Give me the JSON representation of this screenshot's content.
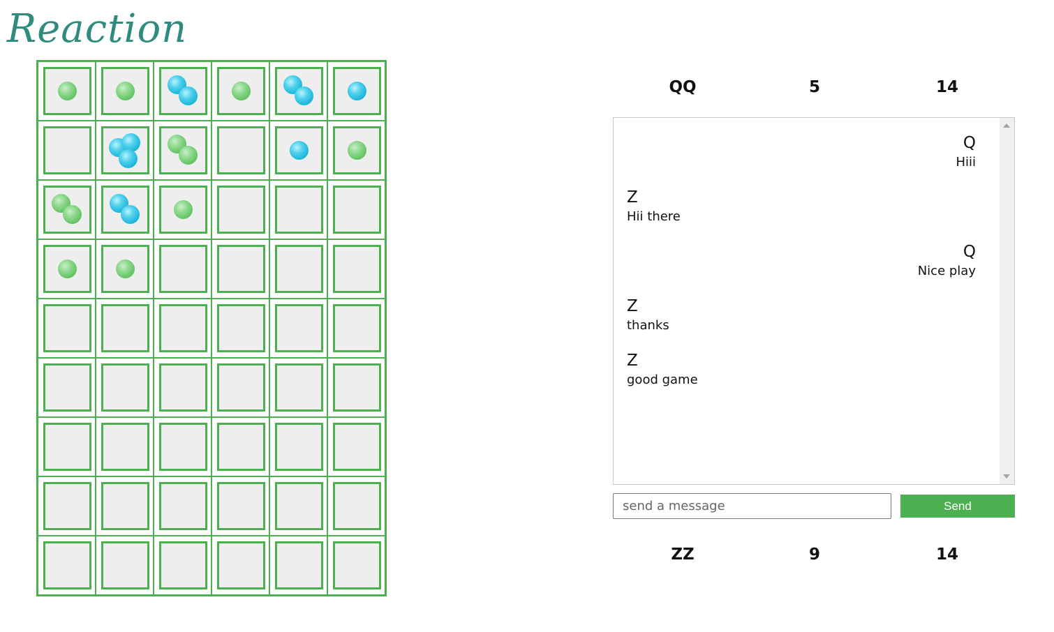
{
  "header": {
    "logo_text": "Reaction"
  },
  "colors": {
    "accent": "#4caf50",
    "logo": "#2e8b7d",
    "orb_green": "#6cc96c",
    "orb_blue": "#1fb8dd"
  },
  "board": {
    "rows": 9,
    "cols": 6,
    "cells": [
      [
        {
          "color": "green",
          "count": 1
        },
        {
          "color": "green",
          "count": 1
        },
        {
          "color": "blue",
          "count": 2
        },
        {
          "color": "green",
          "count": 1
        },
        {
          "color": "blue",
          "count": 2
        },
        {
          "color": "blue",
          "count": 1
        }
      ],
      [
        {
          "color": null,
          "count": 0
        },
        {
          "color": "blue",
          "count": 3
        },
        {
          "color": "green",
          "count": 2
        },
        {
          "color": null,
          "count": 0
        },
        {
          "color": "blue",
          "count": 1
        },
        {
          "color": "green",
          "count": 1
        }
      ],
      [
        {
          "color": "green",
          "count": 2
        },
        {
          "color": "blue",
          "count": 2
        },
        {
          "color": "green",
          "count": 1
        },
        {
          "color": null,
          "count": 0
        },
        {
          "color": null,
          "count": 0
        },
        {
          "color": null,
          "count": 0
        }
      ],
      [
        {
          "color": "green",
          "count": 1
        },
        {
          "color": "green",
          "count": 1
        },
        {
          "color": null,
          "count": 0
        },
        {
          "color": null,
          "count": 0
        },
        {
          "color": null,
          "count": 0
        },
        {
          "color": null,
          "count": 0
        }
      ],
      [
        {
          "color": null,
          "count": 0
        },
        {
          "color": null,
          "count": 0
        },
        {
          "color": null,
          "count": 0
        },
        {
          "color": null,
          "count": 0
        },
        {
          "color": null,
          "count": 0
        },
        {
          "color": null,
          "count": 0
        }
      ],
      [
        {
          "color": null,
          "count": 0
        },
        {
          "color": null,
          "count": 0
        },
        {
          "color": null,
          "count": 0
        },
        {
          "color": null,
          "count": 0
        },
        {
          "color": null,
          "count": 0
        },
        {
          "color": null,
          "count": 0
        }
      ],
      [
        {
          "color": null,
          "count": 0
        },
        {
          "color": null,
          "count": 0
        },
        {
          "color": null,
          "count": 0
        },
        {
          "color": null,
          "count": 0
        },
        {
          "color": null,
          "count": 0
        },
        {
          "color": null,
          "count": 0
        }
      ],
      [
        {
          "color": null,
          "count": 0
        },
        {
          "color": null,
          "count": 0
        },
        {
          "color": null,
          "count": 0
        },
        {
          "color": null,
          "count": 0
        },
        {
          "color": null,
          "count": 0
        },
        {
          "color": null,
          "count": 0
        }
      ],
      [
        {
          "color": null,
          "count": 0
        },
        {
          "color": null,
          "count": 0
        },
        {
          "color": null,
          "count": 0
        },
        {
          "color": null,
          "count": 0
        },
        {
          "color": null,
          "count": 0
        },
        {
          "color": null,
          "count": 0
        }
      ]
    ]
  },
  "players": [
    {
      "name": "QQ",
      "score_a": "5",
      "score_b": "14"
    },
    {
      "name": "ZZ",
      "score_a": "9",
      "score_b": "14"
    }
  ],
  "chat": {
    "messages": [
      {
        "sender": "Q",
        "text": "Hiii",
        "align": "right"
      },
      {
        "sender": "Z",
        "text": "Hii there",
        "align": "left"
      },
      {
        "sender": "Q",
        "text": "Nice play",
        "align": "right"
      },
      {
        "sender": "Z",
        "text": "thanks",
        "align": "left"
      },
      {
        "sender": "Z",
        "text": "good game",
        "align": "left"
      }
    ],
    "input_placeholder": "send a message",
    "input_value": "",
    "send_label": "Send"
  }
}
